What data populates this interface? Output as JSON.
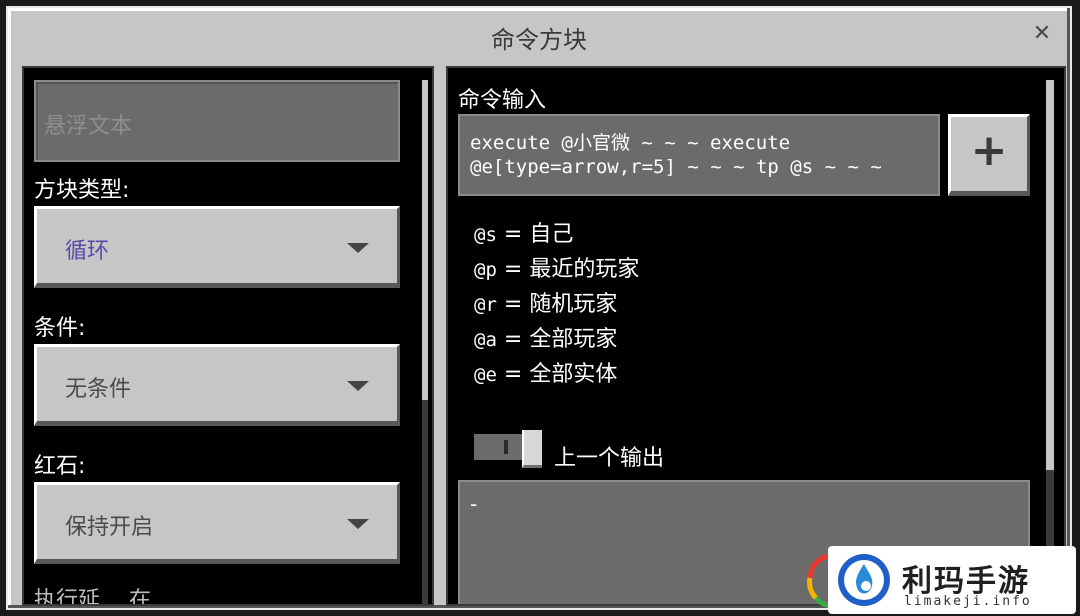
{
  "window": {
    "title": "命令方块"
  },
  "left": {
    "hover_placeholder": "悬浮文本",
    "block_type_label": "方块类型:",
    "block_type_value": "循环",
    "condition_label": "条件:",
    "condition_value": "无条件",
    "redstone_label": "红石:",
    "redstone_value": "保持开启",
    "cutoff_label": "执行延…   在…  …"
  },
  "right": {
    "command_label": "命令输入",
    "command_line1": "execute @小官微 ~ ~ ~ execute",
    "command_line2": "@e[type=arrow,r=5] ~ ~ ~ tp @s ~ ~ ~",
    "add_icon": "plus-icon",
    "selectors": [
      {
        "code": "@s",
        "desc": "= 自己"
      },
      {
        "code": "@p",
        "desc": "= 最近的玩家"
      },
      {
        "code": "@r",
        "desc": "= 随机玩家"
      },
      {
        "code": "@a",
        "desc": "= 全部玩家"
      },
      {
        "code": "@e",
        "desc": "= 全部实体"
      }
    ],
    "previous_output_label": "上一个输出",
    "previous_output_value": "-"
  },
  "watermark": {
    "name": "利玛手游",
    "url": "limakeji.info"
  },
  "colors": {
    "panel_bg": "#c6c6c6",
    "inner_bg": "#000000",
    "input_bg": "#6b6b6b",
    "accent_purple": "#5a4aa8"
  }
}
